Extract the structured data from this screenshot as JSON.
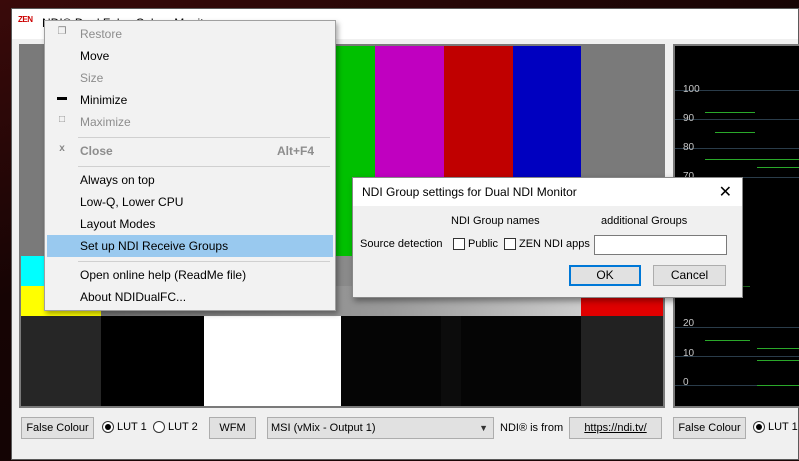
{
  "window": {
    "app_icon": "ZEN",
    "title": "NDI® Dual False Colour Monitor"
  },
  "context_menu": {
    "items": [
      {
        "label": "Restore",
        "icon": "",
        "accelerator": "",
        "disabled": true
      },
      {
        "label": "Move",
        "icon": "",
        "accelerator": "",
        "disabled": false
      },
      {
        "label": "Size",
        "icon": "",
        "accelerator": "",
        "disabled": true
      },
      {
        "label": "Minimize",
        "icon": "",
        "accelerator": "",
        "disabled": false
      },
      {
        "label": "Maximize",
        "icon": "",
        "accelerator": "",
        "disabled": true
      },
      {
        "label": "Close",
        "icon": "x",
        "accelerator": "Alt+F4",
        "disabled": true
      },
      {
        "label": "Always on top",
        "icon": "",
        "accelerator": "",
        "disabled": false
      },
      {
        "label": "Low-Q, Lower CPU",
        "icon": "",
        "accelerator": "",
        "disabled": false
      },
      {
        "label": "Layout Modes",
        "icon": "",
        "accelerator": "",
        "disabled": false
      },
      {
        "label": "Set up NDI Receive Groups",
        "icon": "",
        "accelerator": "",
        "disabled": false,
        "highlighted": true
      },
      {
        "label": "Open online help (ReadMe file)",
        "icon": "",
        "accelerator": "",
        "disabled": false
      },
      {
        "label": "About NDIDualFC...",
        "icon": "",
        "accelerator": "",
        "disabled": false
      }
    ]
  },
  "dialog": {
    "title": "NDI Group settings for Dual NDI Monitor",
    "col_group_names": "NDI Group names",
    "col_additional": "additional Groups",
    "row_label": "Source detection",
    "public_label": "Public",
    "public_checked": false,
    "zen_label": "ZEN NDI apps",
    "zen_checked": false,
    "additional_value": "",
    "ok_label": "OK",
    "cancel_label": "Cancel"
  },
  "waveform_scale": [
    "100",
    "90",
    "80",
    "70",
    "20",
    "10",
    "0"
  ],
  "bottom": {
    "false_colour_label": "False Colour",
    "lut1_label": "LUT 1",
    "lut2_label": "LUT 2",
    "lut_selected": "LUT 1",
    "wfm_label": "WFM",
    "source_value": "MSI (vMix - Output 1)",
    "ndi_from_label": "NDI® is from",
    "ndi_link": "https://ndi.tv/",
    "right_false_colour_label": "False Colour",
    "right_lut1_label": "LUT 1"
  },
  "colors": {
    "highlight": "#99c9ef",
    "default_button_border": "#0078d7"
  }
}
